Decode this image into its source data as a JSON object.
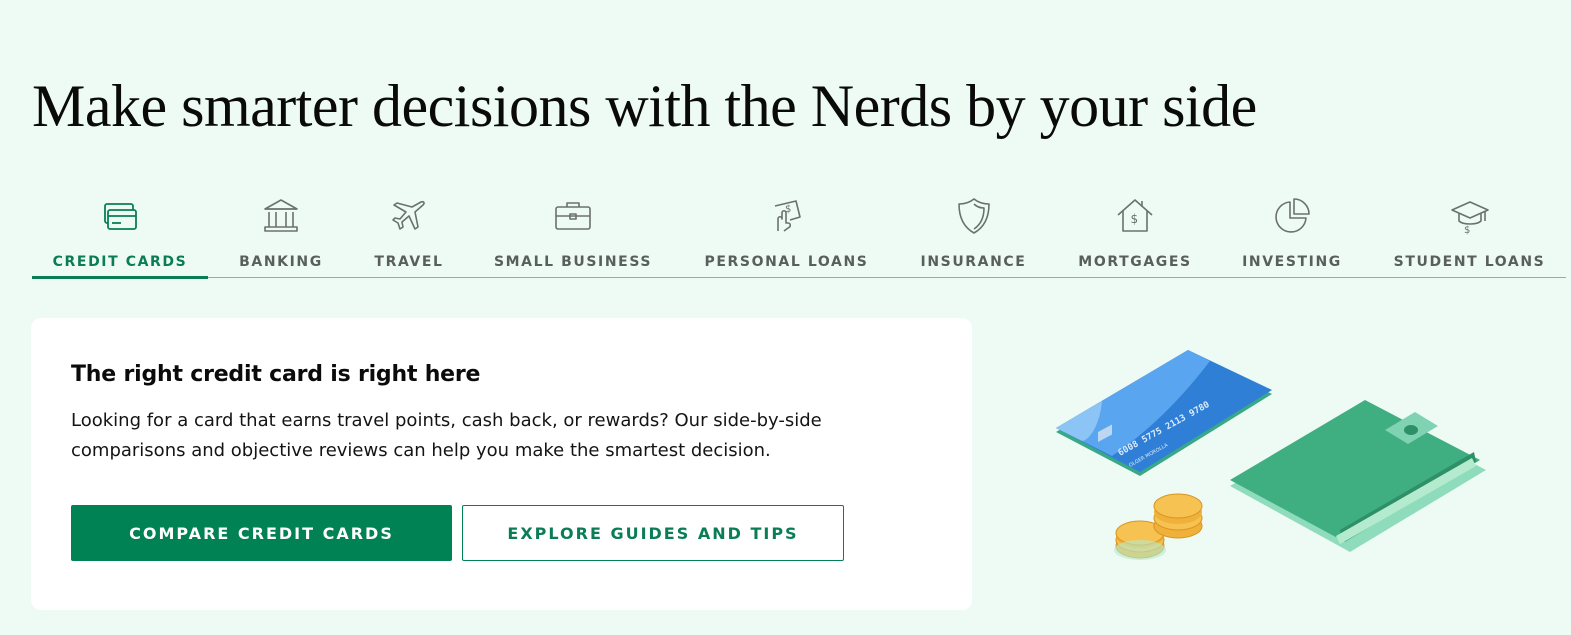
{
  "hero": {
    "title": "Make smarter decisions with the Nerds by your side"
  },
  "tabs": [
    {
      "label": "CREDIT CARDS",
      "icon": "credit-card-icon",
      "active": true
    },
    {
      "label": "BANKING",
      "icon": "bank-icon",
      "active": false
    },
    {
      "label": "TRAVEL",
      "icon": "airplane-icon",
      "active": false
    },
    {
      "label": "SMALL BUSINESS",
      "icon": "briefcase-icon",
      "active": false
    },
    {
      "label": "PERSONAL LOANS",
      "icon": "hand-money-icon",
      "active": false
    },
    {
      "label": "INSURANCE",
      "icon": "shield-icon",
      "active": false
    },
    {
      "label": "MORTGAGES",
      "icon": "house-dollar-icon",
      "active": false
    },
    {
      "label": "INVESTING",
      "icon": "pie-chart-icon",
      "active": false
    },
    {
      "label": "STUDENT LOANS",
      "icon": "graduation-cap-icon",
      "active": false
    }
  ],
  "card": {
    "title": "The right credit card is right here",
    "body_line1": "Looking for a card that earns travel points, cash back, or rewards? Our side-by-side",
    "body_line2": "comparisons and objective reviews can help you make the smartest decision.",
    "primary_button": "COMPARE CREDIT CARDS",
    "secondary_button": "EXPLORE GUIDES AND TIPS"
  },
  "illustration": {
    "card_number": "6008 5775 2113 9780",
    "card_name": "OLGER MOROLLA"
  },
  "colors": {
    "background": "#eefbf5",
    "accent": "#008255",
    "tab_text": "#595f5c",
    "card_blue": "#2f7fd6",
    "wallet_green": "#3fae80",
    "coin": "#f0b13a"
  }
}
